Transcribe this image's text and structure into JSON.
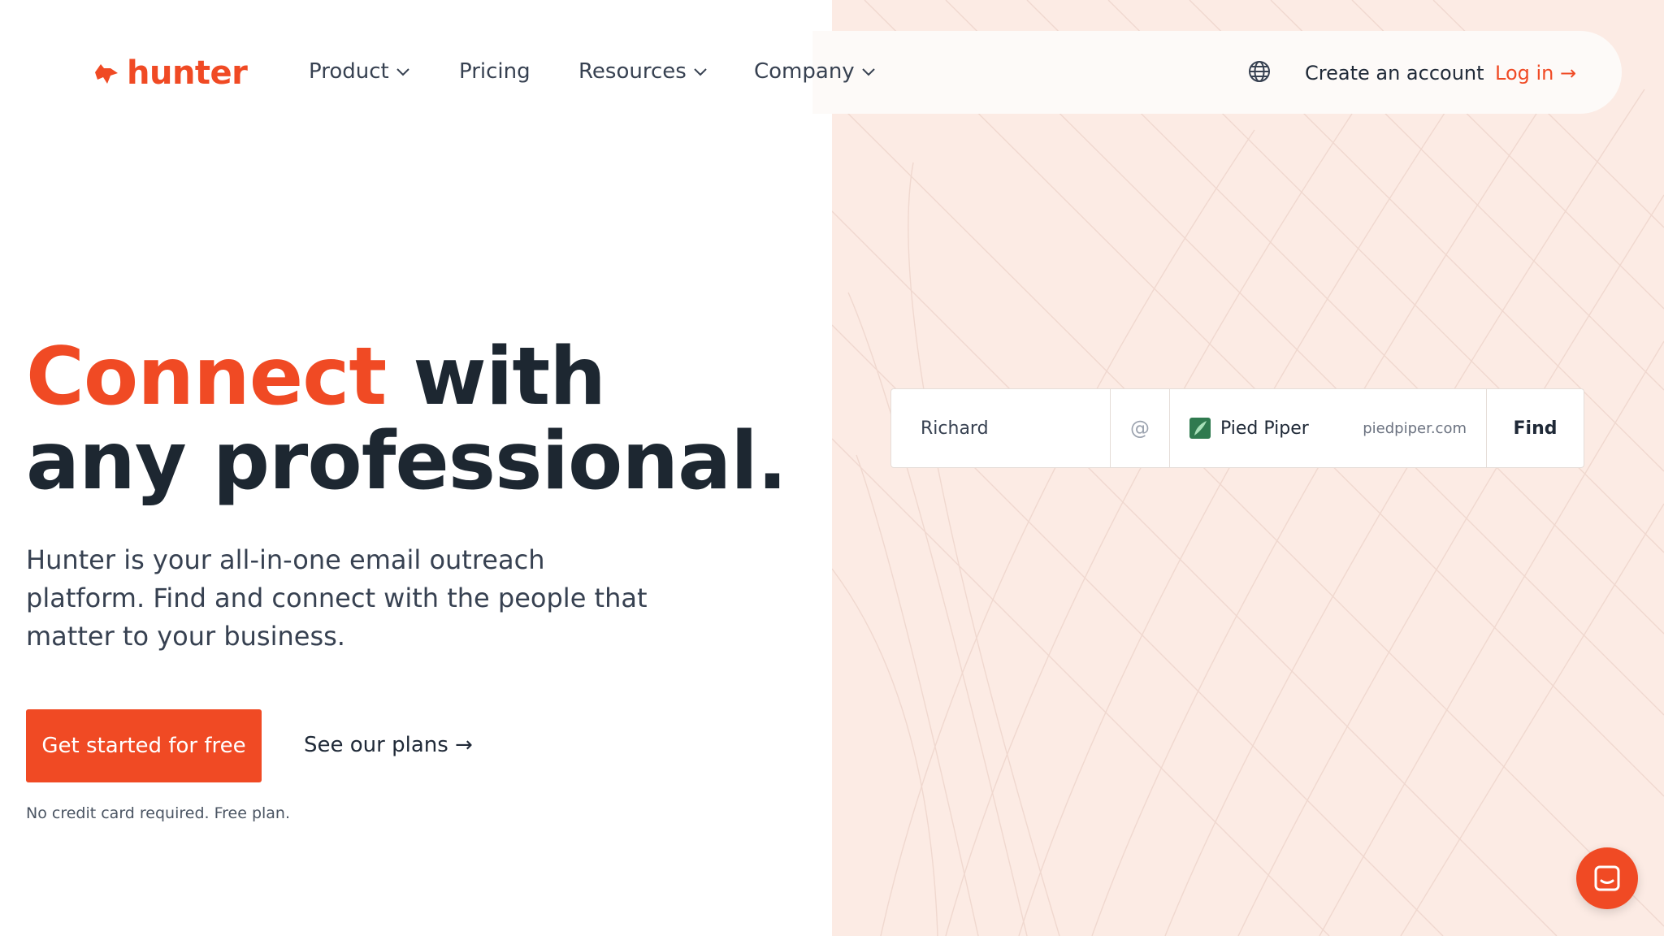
{
  "brand": {
    "name": "hunter",
    "accent_color": "#f04a24",
    "bg_right": "#fcebe4"
  },
  "nav": {
    "items": [
      {
        "label": "Product",
        "dropdown": true
      },
      {
        "label": "Pricing",
        "dropdown": false
      },
      {
        "label": "Resources",
        "dropdown": true
      },
      {
        "label": "Company",
        "dropdown": true
      }
    ],
    "language_icon": "globe-icon",
    "create_account": "Create an account",
    "login": "Log in →"
  },
  "hero": {
    "headline_accent": "Connect",
    "headline_rest_line1": " with",
    "headline_line2": "any professional.",
    "description": "Hunter is your all-in-one email outreach platform. Find and connect with the people that matter to your business.",
    "cta_primary": "Get started for free",
    "cta_secondary": "See our plans →",
    "note": "No credit card required. Free plan."
  },
  "finder": {
    "name_value": "Richard",
    "at_symbol": "@",
    "company_name": "Pied Piper",
    "company_domain": "piedpiper.com",
    "company_logo_color": "#2f7a4f",
    "find_label": "Find"
  },
  "chat": {
    "icon": "chat-icon"
  }
}
